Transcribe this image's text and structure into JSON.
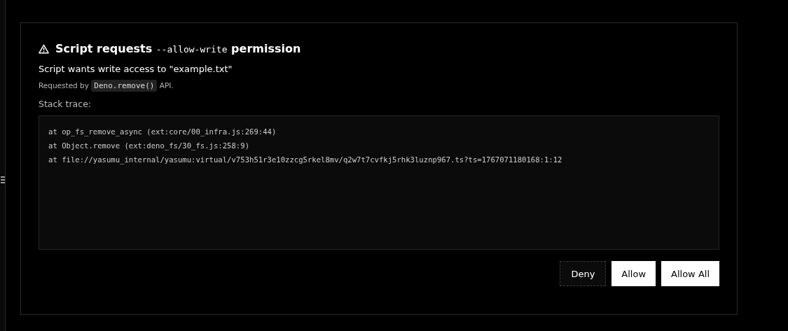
{
  "dialog": {
    "title": {
      "before": "Script requests",
      "flag": "--allow-write",
      "after": "permission"
    },
    "message": "Script wants write access to \"example.txt\"",
    "requested_by": {
      "before": "Requested by",
      "api": "Deno.remove()",
      "after": "API."
    },
    "stack_label": "Stack trace:",
    "stack_trace": [
      "at op_fs_remove_async (ext:core/00_infra.js:269:44)",
      "at Object.remove (ext:deno_fs/30_fs.js:258:9)",
      "at file://yasumu_internal/yasumu:virtual/v753h51r3e10zzcg5rkel8mv/q2w7t7cvfkj5rhk3luznp967.ts?ts=1767071180168:1:12"
    ],
    "buttons": [
      {
        "label": "Deny",
        "kind": "outline"
      },
      {
        "label": "Allow",
        "kind": "solid"
      },
      {
        "label": "Allow All",
        "kind": "solid"
      }
    ]
  }
}
